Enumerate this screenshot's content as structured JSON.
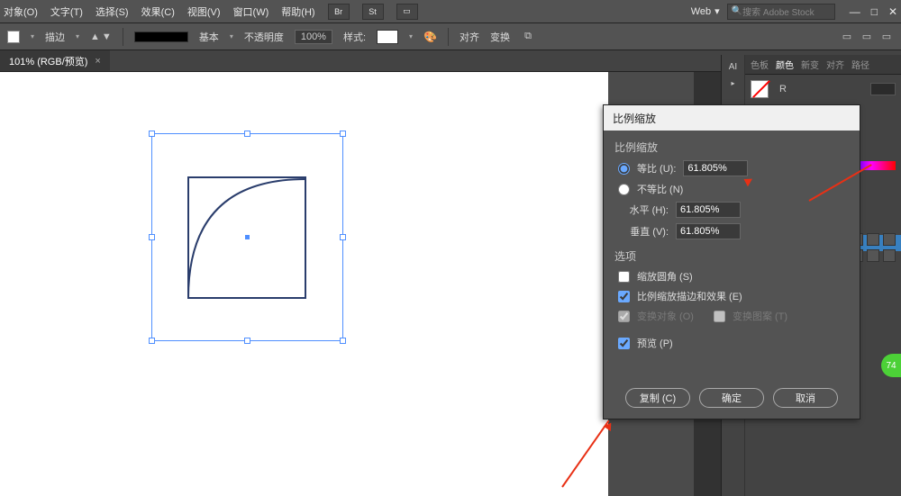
{
  "menubar": {
    "items": [
      "对象(O)",
      "文字(T)",
      "选择(S)",
      "效果(C)",
      "视图(V)",
      "窗口(W)",
      "帮助(H)"
    ],
    "chips": [
      "Br",
      "St"
    ],
    "workspace_label": "Web",
    "search_placeholder": "搜索 Adobe Stock"
  },
  "ctrlbar": {
    "stroke_label": "描边",
    "basic_label": "基本",
    "opacity_label": "不透明度",
    "opacity_value": "100%",
    "style_label": "样式:",
    "align_label": "对齐",
    "transform_label": "变换"
  },
  "tabbar": {
    "doc_title": "101% (RGB/预览)",
    "close": "×"
  },
  "rightpanel": {
    "strip_label": "AI",
    "tabs": [
      "色板",
      "颜色",
      "新变",
      "对齐",
      "路径"
    ],
    "r_label": "R"
  },
  "dialog": {
    "title": "比例缩放",
    "section1": "比例缩放",
    "uniform_label": "等比 (U):",
    "uniform_value": "61.805%",
    "nonuniform_label": "不等比 (N)",
    "horiz_label": "水平 (H):",
    "horiz_value": "61.805%",
    "vert_label": "垂直 (V):",
    "vert_value": "61.805%",
    "section2": "选项",
    "opt_corner": "缩放圆角 (S)",
    "opt_strokes": "比例缩放描边和效果 (E)",
    "opt_transobj": "变换对象 (O)",
    "opt_transpat": "变换图案 (T)",
    "preview_label": "预览 (P)",
    "btn_copy": "复制 (C)",
    "btn_ok": "确定",
    "btn_cancel": "取消"
  },
  "badge": {
    "value": "74"
  }
}
